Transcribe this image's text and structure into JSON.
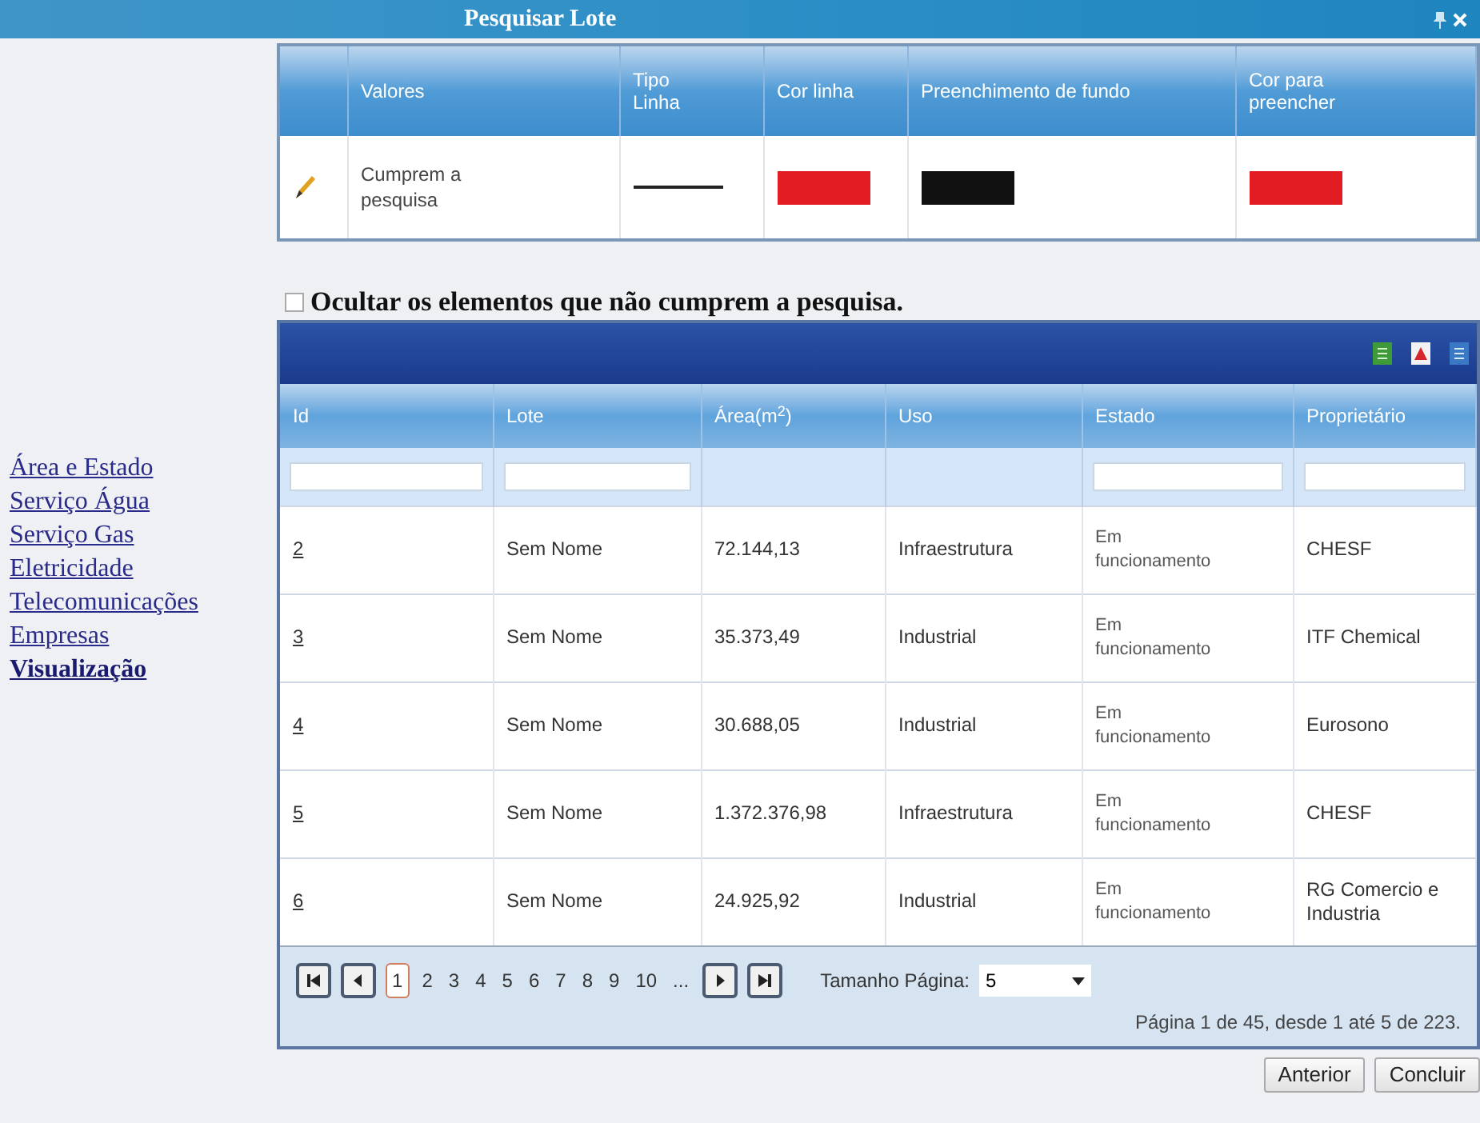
{
  "window": {
    "title": "Pesquisar Lote"
  },
  "sidebar": {
    "items": [
      {
        "label": "Área e Estado",
        "selected": false
      },
      {
        "label": "Serviço Água",
        "selected": false
      },
      {
        "label": "Serviço Gas",
        "selected": false
      },
      {
        "label": "Eletricidade",
        "selected": false
      },
      {
        "label": "Telecomunicações",
        "selected": false
      },
      {
        "label": "Empresas",
        "selected": false
      },
      {
        "label": "Visualização",
        "selected": true
      }
    ]
  },
  "style_table": {
    "columns": [
      "",
      "Valores",
      "Tipo Linha",
      "Cor linha",
      "Preenchimento de fundo",
      "Cor para preencher"
    ],
    "rows": [
      {
        "cells": [
          {
            "kind": "edit"
          },
          {
            "kind": "text",
            "text": "Cumprem a pesquisa"
          },
          {
            "kind": "line"
          },
          {
            "kind": "swatch",
            "color": "#e31b23"
          },
          {
            "kind": "swatch",
            "color": "#111111"
          },
          {
            "kind": "swatch",
            "color": "#e31b23"
          }
        ]
      }
    ]
  },
  "hide_option": {
    "label": "Ocultar os elementos que não cumprem a pesquisa.",
    "checked": false
  },
  "grid": {
    "columns": [
      {
        "label": "Id",
        "filter": {
          "kind": "field"
        }
      },
      {
        "label": "Lote",
        "filter": {
          "kind": "field"
        }
      },
      {
        "label": "Área(m$^{2}$)"
      },
      {
        "label": "Uso"
      },
      {
        "label": "Estado",
        "filter": {
          "kind": "field"
        }
      },
      {
        "label": "Proprietário",
        "filter": {
          "kind": "field"
        }
      }
    ],
    "rows": [
      [
        "2",
        "Sem Nome",
        "72.144,13",
        "Infraestrutura",
        "Em funcionamento",
        "CHESF"
      ],
      [
        "3",
        "Sem Nome",
        "35.373,49",
        "Industrial",
        "Em funcionamento",
        "ITF Chemical"
      ],
      [
        "4",
        "Sem Nome",
        "30.688,05",
        "Industrial",
        "Em funcionamento",
        "Eurosono"
      ],
      [
        "5",
        "Sem Nome",
        "1.372.376,98",
        "Infraestrutura",
        "Em funcionamento",
        "CHESF"
      ],
      [
        "6",
        "Sem Nome",
        "24.925,92",
        "Industrial",
        "Em funcionamento",
        "RG Comercio e Industria"
      ]
    ],
    "pager": {
      "pages": [
        {
          "label": "1",
          "selected": true
        },
        {
          "label": "2",
          "selected": false
        },
        {
          "label": "3",
          "selected": false
        },
        {
          "label": "4",
          "selected": false
        },
        {
          "label": "5",
          "selected": false
        },
        {
          "label": "6",
          "selected": false
        },
        {
          "label": "7",
          "selected": false
        },
        {
          "label": "8",
          "selected": false
        },
        {
          "label": "9",
          "selected": false
        },
        {
          "label": "10",
          "selected": false
        },
        {
          "label": "...",
          "selected": false
        }
      ],
      "page_size_label": "Tamanho Página:",
      "page_size": "5",
      "info": "Página 1 de 45, desde 1 até 5 de 223."
    }
  },
  "buttons": [
    "Anterior",
    "Concluir"
  ]
}
